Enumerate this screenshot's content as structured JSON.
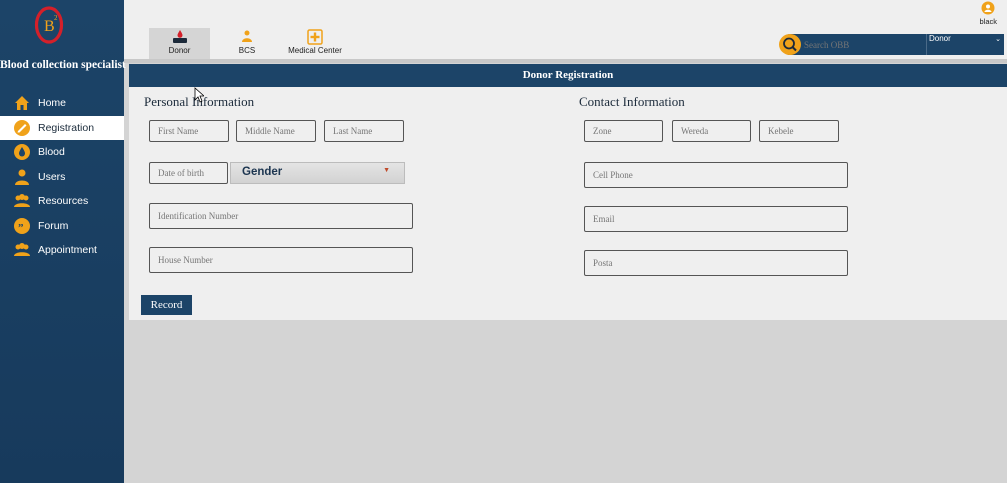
{
  "app": {
    "logo_letter": "B",
    "logo_superscript": "2",
    "title": "Blood collection specialist"
  },
  "sidebar": {
    "items": [
      {
        "label": "Home",
        "icon": "home-icon"
      },
      {
        "label": "Registration",
        "icon": "registration-icon",
        "active": true
      },
      {
        "label": "Blood",
        "icon": "blood-icon"
      },
      {
        "label": "Users",
        "icon": "users-icon"
      },
      {
        "label": "Resources",
        "icon": "resources-icon"
      },
      {
        "label": "Forum",
        "icon": "forum-icon"
      },
      {
        "label": "Appointment",
        "icon": "appointment-icon"
      }
    ]
  },
  "topbar": {
    "tabs": [
      {
        "label": "Donor",
        "icon": "donor-icon",
        "active": true
      },
      {
        "label": "BCS",
        "icon": "bcs-icon"
      },
      {
        "label": "Medical Center",
        "icon": "medical-center-icon"
      }
    ],
    "user": {
      "name": "black",
      "icon": "user-icon"
    },
    "search": {
      "placeholder": "Search OBB",
      "icon": "search-icon"
    },
    "select": {
      "value": "Donor",
      "icon": "chevron-down-icon"
    }
  },
  "form": {
    "title": "Donor Registration",
    "personal": {
      "title": "Personal Information",
      "first_name": "First Name",
      "middle_name": "Middle Name",
      "last_name": "Last Name",
      "dob": "Date of birth",
      "gender": "Gender",
      "id_number": "Identification Number",
      "house_number": "House Number"
    },
    "contact": {
      "title": "Contact Information",
      "zone": "Zone",
      "wereda": "Wereda",
      "kebele": "Kebele",
      "cell_phone": "Cell Phone",
      "email": "Email",
      "posta": "Posta"
    },
    "record_label": "Record"
  },
  "colors": {
    "navy": "#1c4468",
    "accent": "#f0a21a",
    "logo_red": "#d4202a"
  }
}
